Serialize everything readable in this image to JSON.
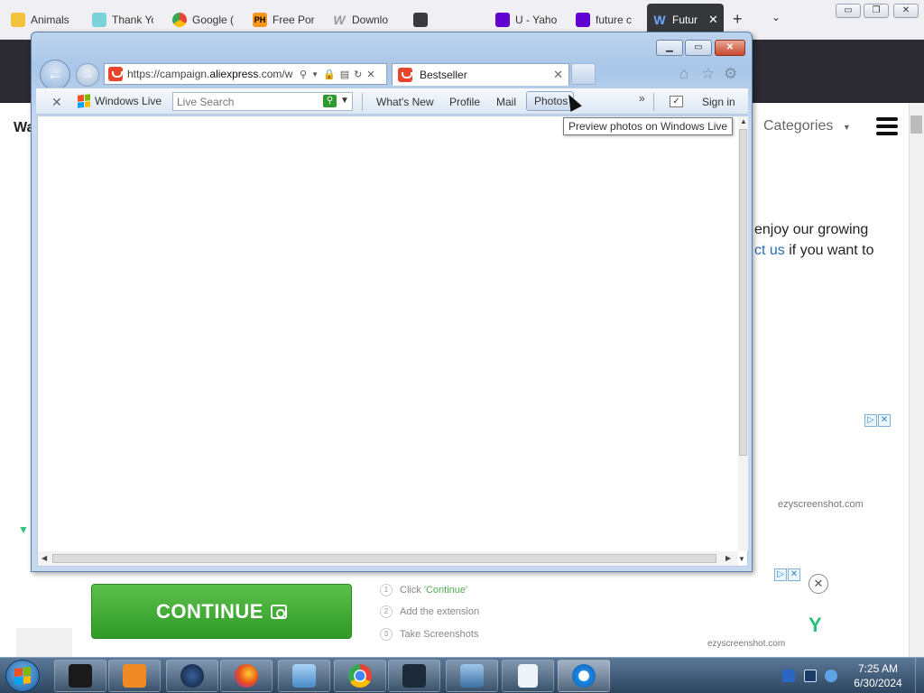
{
  "firefox": {
    "tabs": [
      {
        "label": "Animals",
        "icon": "animal-emoji-icon"
      },
      {
        "label": "Thank Yo",
        "icon": "mail-icon"
      },
      {
        "label": "Google (",
        "icon": "chrome-icon"
      },
      {
        "label": "Free Por",
        "icon": "ph-icon"
      },
      {
        "label": "Downlo",
        "icon": "w-icon"
      },
      {
        "label": "",
        "icon": "tab-icon"
      },
      {
        "label": "U - Yaho",
        "icon": "yahoo-icon"
      },
      {
        "label": "future c",
        "icon": "yahoo-icon"
      },
      {
        "label": "Futur",
        "icon": "w-icon"
      }
    ],
    "ph_badge": "PH"
  },
  "background_page": {
    "heading_fragment": "Wa",
    "categories_label": "Categories",
    "text_line1": "enjoy our growing",
    "text_line2_link": "ct us",
    "text_line2_rest": " if you want to",
    "ad_watermark": "ezyscreenshot.com"
  },
  "ad": {
    "continue_label": "CONTINUE",
    "steps": [
      {
        "num": "1",
        "text": "Click ",
        "highlight": "'Continue'"
      },
      {
        "num": "2",
        "text": "Add the extension",
        "highlight": ""
      },
      {
        "num": "3",
        "text": "Take Screenshots",
        "highlight": ""
      }
    ],
    "watermark": "ezyscreenshot.com"
  },
  "ie": {
    "url_prefix": "https://campaign.",
    "url_domain": "aliexpress",
    "url_suffix": ".com/w",
    "tab_title": "Bestseller",
    "toolbar": {
      "windows_live_label": "Windows Live",
      "search_placeholder": "Live Search",
      "links": [
        "What's New",
        "Profile",
        "Mail"
      ],
      "photos_label": "Photos",
      "sign_in_label": "Sign in"
    },
    "tooltip": "Preview photos on Windows Live"
  },
  "taskbar": {
    "time": "7:25 AM",
    "date": "6/30/2024",
    "items": [
      "dark-window-app",
      "media-player",
      "globe-app",
      "firefox",
      "media-center",
      "chrome",
      "monitor-app",
      "photo-viewer",
      "notepad",
      "internet-explorer"
    ]
  },
  "colors": {
    "ie_frame": "#a9c6e8",
    "continue_green": "#3fa833",
    "firefox_dark": "#2b2a33",
    "link_blue": "#2a6db0"
  }
}
